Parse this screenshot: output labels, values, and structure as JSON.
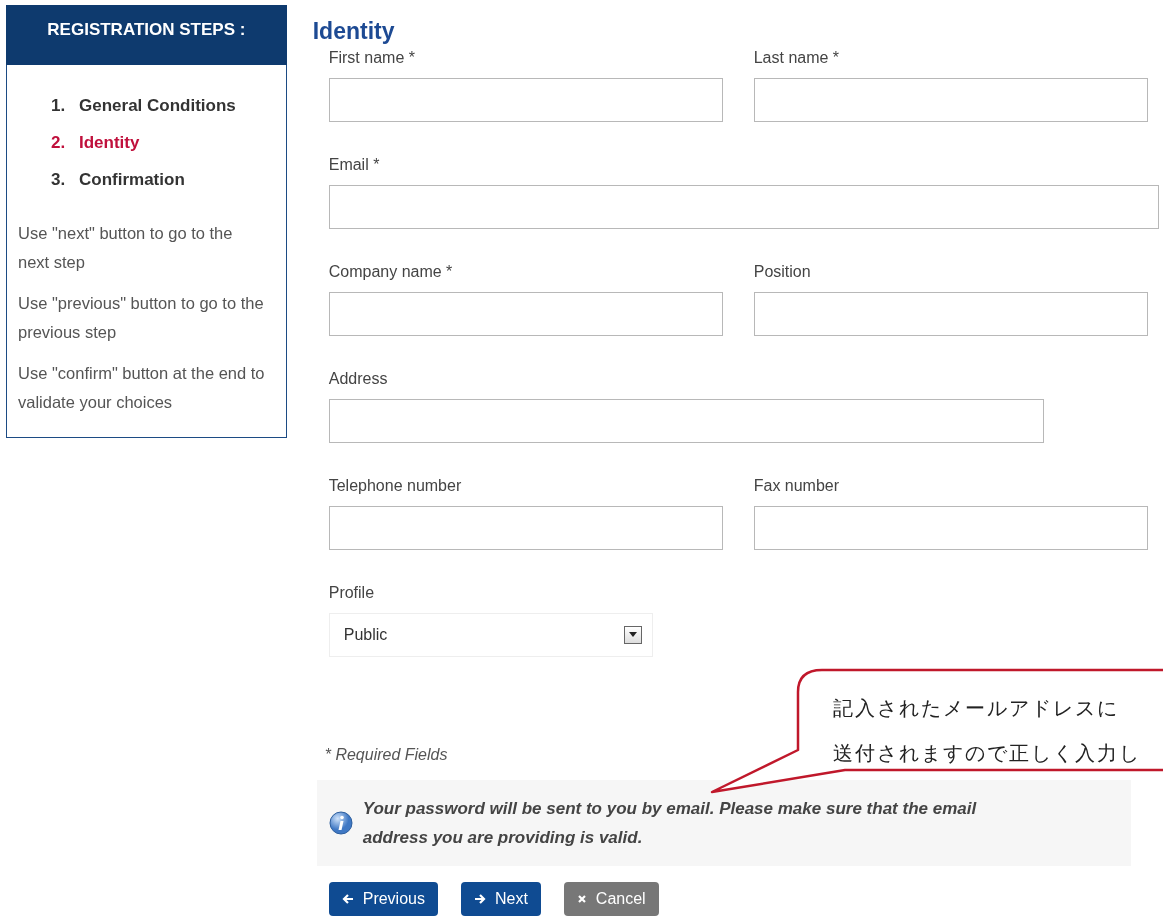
{
  "sidebar": {
    "title": "REGISTRATION STEPS :",
    "steps": [
      {
        "number": "1.",
        "label": "General Conditions",
        "selected": false
      },
      {
        "number": "2.",
        "label": "Identity",
        "selected": true
      },
      {
        "number": "3.",
        "label": "Confirmation",
        "selected": false
      }
    ],
    "hints": [
      "Use \"next\" button to go to the next step",
      "Use \"previous\" button to go to the previous step",
      "Use \"confirm\" button at the end to validate your choices"
    ]
  },
  "form": {
    "title": "Identity",
    "rows": [
      [
        {
          "label": "First name *",
          "kind": "text"
        },
        {
          "label": "Last name *",
          "kind": "text"
        }
      ],
      [
        {
          "label": "Email *",
          "kind": "email"
        }
      ],
      [
        {
          "label": "Company name *",
          "kind": "text"
        },
        {
          "label": "Position",
          "kind": "text"
        }
      ],
      [
        {
          "label": "Address",
          "kind": "address"
        }
      ],
      [
        {
          "label": "Telephone number",
          "kind": "text"
        },
        {
          "label": "Fax number",
          "kind": "text"
        }
      ],
      [
        {
          "label": "Profile",
          "kind": "select",
          "value": "Public"
        }
      ]
    ],
    "required_note": "* Required Fields",
    "info": "Your password will be sent to you by email. Please make sure that the email address you are providing is valid.",
    "buttons": [
      {
        "label": "Previous",
        "kind": "previous"
      },
      {
        "label": "Next",
        "kind": "next"
      },
      {
        "label": "Cancel",
        "kind": "cancel"
      }
    ]
  },
  "callout": {
    "lines": [
      "記入されたメールアドレスに",
      "送付されますので正しく入力し"
    ]
  }
}
